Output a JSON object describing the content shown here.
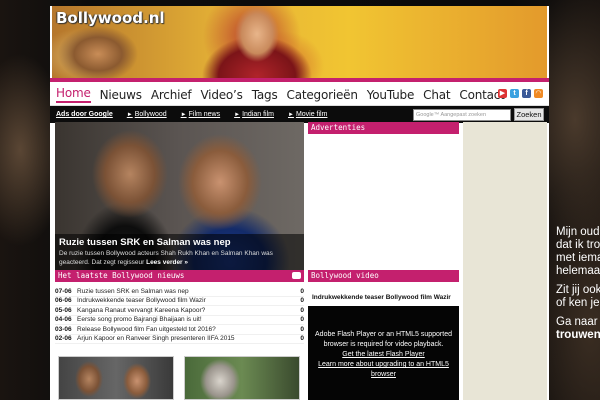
{
  "site": {
    "logo": "Bollywood.nl"
  },
  "nav": {
    "items": [
      "Home",
      "Nieuws",
      "Archief",
      "Video’s",
      "Tags",
      "Categorieën",
      "YouTube",
      "Chat",
      "Contact"
    ],
    "active": "Home"
  },
  "social": [
    "youtube-icon",
    "twitter-icon",
    "facebook-icon",
    "rss-icon"
  ],
  "subnav": {
    "ads_label": "Ads door Google",
    "links": [
      "Bollywood",
      "Film news",
      "Indian film",
      "Movie film"
    ]
  },
  "search": {
    "placeholder": "Google™ Aangepast zoeken",
    "button": "Zoeken"
  },
  "hero": {
    "title": "Ruzie tussen SRK en Salman was nep",
    "text": "De ruzie tussen Bollywood acteurs Shah Rukh Khan en Salman Khan was geacteerd. Dat zegt regisseur",
    "more": "Lees verder »"
  },
  "ads_box": {
    "title": "Advertenties"
  },
  "news": {
    "title": "Het laatste Bollywood nieuws",
    "rows": [
      {
        "date": "07-06",
        "title": "Ruzie tussen SRK en Salman was nep",
        "count": "0"
      },
      {
        "date": "06-06",
        "title": "Indrukwekkende teaser Bollywood film Wazir",
        "count": "0"
      },
      {
        "date": "05-06",
        "title": "Kangana Ranaut vervangt Kareena Kapoor?",
        "count": "0"
      },
      {
        "date": "04-06",
        "title": "Eerste song promo Bajrangi Bhaijaan is uit!",
        "count": "0"
      },
      {
        "date": "03-06",
        "title": "Release Bollywood film Fan uitgesteld tot 2016?",
        "count": "0"
      },
      {
        "date": "02-06",
        "title": "Arjun Kapoor en Ranveer Singh presenteren IIFA 2015",
        "count": "0"
      }
    ]
  },
  "video": {
    "box_title": "Bollywood video",
    "title": "Indrukwekkende teaser Bollywood film Wazir",
    "flash_msg": "Adobe Flash Player or an HTML5 supported browser is required for video playback.",
    "link1": "Get the latest Flash Player",
    "link2": "Learn more about upgrading to an HTML5 browser"
  },
  "side_ad": {
    "lines1": [
      "Mijn oud",
      "dat ik tro",
      "met iema",
      "helemaa"
    ],
    "lines2": [
      "Zit jij ook",
      "of ken je i"
    ],
    "lines3": [
      "Ga naar",
      "trouwen"
    ]
  }
}
